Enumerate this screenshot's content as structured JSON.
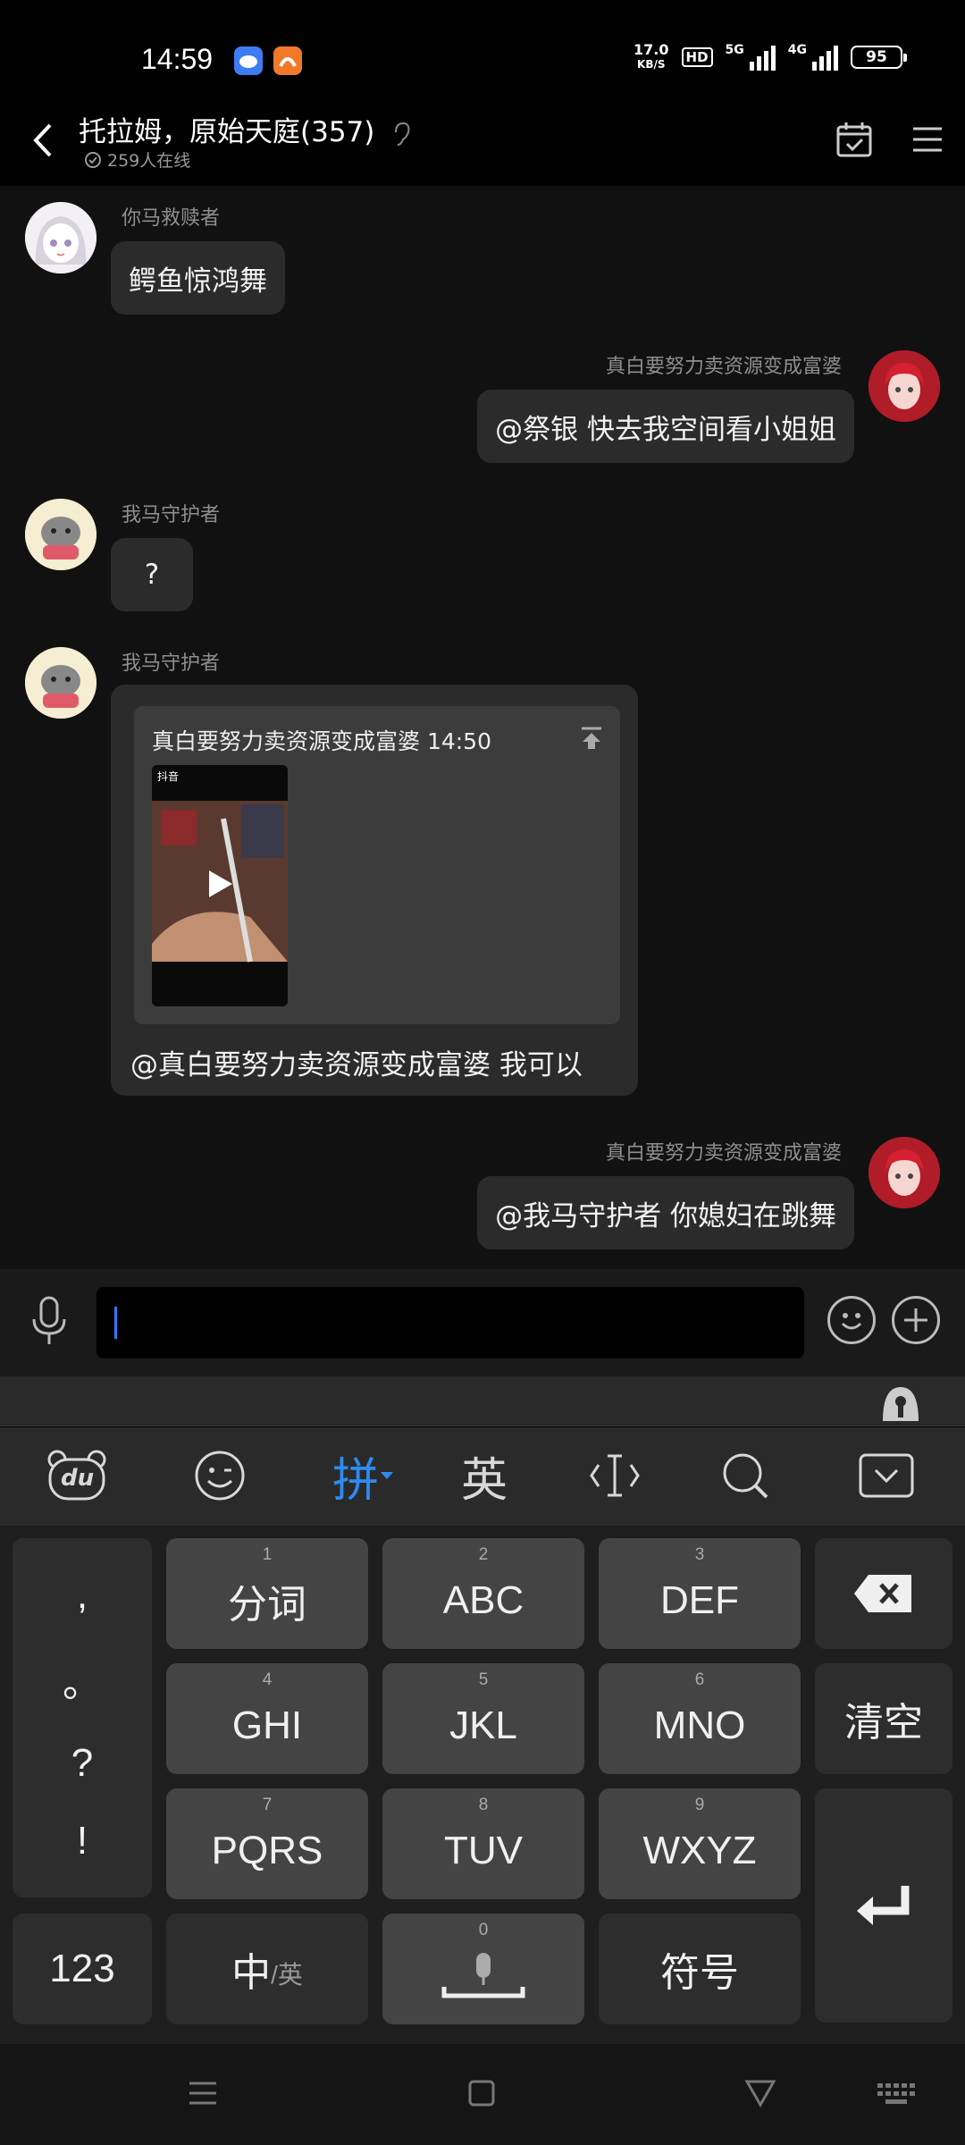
{
  "status": {
    "time": "14:59",
    "speed_value": "17.0",
    "speed_unit": "KB/S",
    "hd": "HD",
    "net_a": "5G",
    "net_b": "4G",
    "battery": "95"
  },
  "header": {
    "title": "托拉姆，原始天庭(357)",
    "online": "259人在线"
  },
  "messages": [
    {
      "sender": "你马救赎者",
      "text": "鳄鱼惊鸿舞"
    },
    {
      "sender": "真白要努力卖资源变成富婆",
      "text": "@祭银 快去我空间看小姐姐"
    },
    {
      "sender": "我马守护者",
      "text": "?"
    },
    {
      "sender": "我马守护者",
      "quote_header": "真白要努力卖资源变成富婆 14:50",
      "thumb_brand": "抖音",
      "text": "@真白要努力卖资源变成富婆 我可以"
    },
    {
      "sender": "真白要努力卖资源变成富婆",
      "text": "@我马守护者 你媳妇在跳舞"
    }
  ],
  "keyboard": {
    "toolbar": {
      "pinyin": "拼",
      "english": "英",
      "du": "du"
    },
    "punct": [
      ",",
      "。",
      "?",
      "!"
    ],
    "rows": [
      {
        "num": "1",
        "label": "分词"
      },
      {
        "num": "2",
        "label": "ABC"
      },
      {
        "num": "3",
        "label": "DEF"
      },
      {
        "num": "4",
        "label": "GHI"
      },
      {
        "num": "5",
        "label": "JKL"
      },
      {
        "num": "6",
        "label": "MNO"
      },
      {
        "num": "7",
        "label": "PQRS"
      },
      {
        "num": "8",
        "label": "TUV"
      },
      {
        "num": "9",
        "label": "WXYZ"
      }
    ],
    "clear": "清空",
    "num123": "123",
    "zh": "中",
    "zh_sub": "/英",
    "space_num": "0",
    "symbols": "符号"
  }
}
